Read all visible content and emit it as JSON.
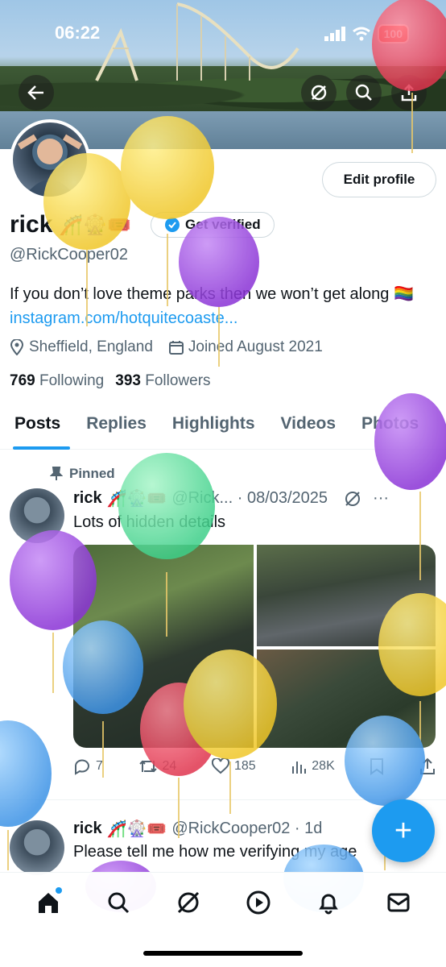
{
  "status_bar": {
    "time": "06:22",
    "battery": "100"
  },
  "header": {
    "back_icon": "arrow-left-icon",
    "grok_icon": "grok-icon",
    "search_icon": "search-icon",
    "share_icon": "share-icon"
  },
  "profile": {
    "name": "rick",
    "name_emoji": "🎢🎡🎟️",
    "get_verified_label": "Get verified",
    "edit_profile_label": "Edit profile",
    "handle": "@RickCooper02",
    "bio_text": "If you don’t love theme parks then we won’t get along 🏳️‍🌈",
    "bio_link": "instagram.com/hotquitecoaste...",
    "location": "Sheffield, England",
    "joined": "Joined August 2021",
    "following_count": "769",
    "following_label": "Following",
    "followers_count": "393",
    "followers_label": "Followers"
  },
  "tabs": [
    "Posts",
    "Replies",
    "Highlights",
    "Videos",
    "Photos"
  ],
  "posts": [
    {
      "pinned_label": "Pinned",
      "name": "rick",
      "emoji": "🎢🎡🎟️",
      "handle_date": "@Rick... · 08/03/2025",
      "text": "Lots of hidden details",
      "replies": "7",
      "reposts": "24",
      "likes": "185",
      "views": "28K"
    },
    {
      "name": "rick",
      "emoji": "🎢🎡🎟️",
      "handle_date": "@RickCooper02 · 1d",
      "text": "Please tell me how me verifying my age"
    }
  ],
  "fab_label": "+",
  "nav": [
    "home-icon",
    "search-icon",
    "grok-icon",
    "play-icon",
    "bell-icon",
    "mail-icon"
  ],
  "colors": {
    "accent": "#1d9bf0",
    "text": "#0f1419",
    "muted": "#536471",
    "battery": "#ff3b30"
  }
}
